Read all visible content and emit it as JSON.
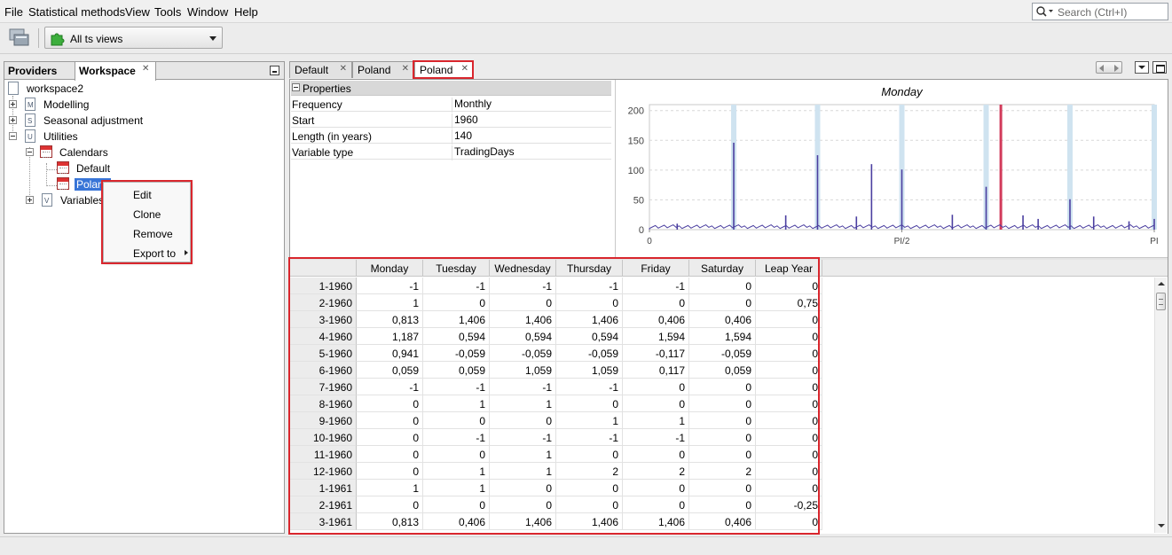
{
  "menubar": {
    "items": [
      "File",
      "Statistical methods",
      "View",
      "Tools",
      "Window",
      "Help"
    ],
    "search_placeholder": "Search (Ctrl+I)"
  },
  "toolbar": {
    "views_combo": "All ts views"
  },
  "left_panel": {
    "tabs": [
      "Providers",
      "Workspace"
    ],
    "tree": {
      "root": "workspace2",
      "modelling": "Modelling",
      "seasonal": "Seasonal adjustment",
      "utilities": "Utilities",
      "calendars": "Calendars",
      "cal_default": "Default",
      "cal_poland": "Poland",
      "variables": "Variables"
    },
    "icons": {
      "modelling": "M",
      "seasonal": "S",
      "utilities": "U",
      "variables": "V"
    }
  },
  "context_menu": {
    "items": [
      "Edit",
      "Clone",
      "Remove",
      "Export to"
    ]
  },
  "editor_tabs": [
    "Default",
    "Poland",
    "Poland"
  ],
  "properties": {
    "header": "Properties",
    "rows": [
      {
        "key": "Frequency",
        "value": "Monthly"
      },
      {
        "key": "Start",
        "value": "1960"
      },
      {
        "key": "Length (in years)",
        "value": "140"
      },
      {
        "key": "Variable type",
        "value": "TradingDays"
      }
    ]
  },
  "chart_data": {
    "type": "bar",
    "title": "Monday",
    "xlabel": "",
    "ylabel": "",
    "x_ticks": [
      "0",
      "PI/2",
      "PI"
    ],
    "y_ticks": [
      0,
      50,
      100,
      150,
      200
    ],
    "ylim": [
      0,
      210
    ],
    "xlim": [
      0,
      1
    ],
    "series_color": "#4b3fa0",
    "highlight_color": "#d23a5a",
    "band_color": "#cfe3f0",
    "peaks": [
      {
        "x": 0.167,
        "value": 146
      },
      {
        "x": 0.333,
        "value": 125
      },
      {
        "x": 0.5,
        "value": 101
      },
      {
        "x": 0.667,
        "value": 72
      },
      {
        "x": 0.833,
        "value": 51
      },
      {
        "x": 1.0,
        "value": 18
      },
      {
        "x": 0.44,
        "value": 110
      },
      {
        "x": 0.055,
        "value": 10
      },
      {
        "x": 0.27,
        "value": 24
      },
      {
        "x": 0.41,
        "value": 22
      },
      {
        "x": 0.6,
        "value": 25
      },
      {
        "x": 0.74,
        "value": 24
      },
      {
        "x": 0.77,
        "value": 18
      },
      {
        "x": 0.88,
        "value": 22
      },
      {
        "x": 0.95,
        "value": 14
      }
    ],
    "bands_x": [
      0.167,
      0.333,
      0.5,
      0.667,
      0.833,
      1.0
    ],
    "highlight_x": 0.697
  },
  "table": {
    "columns": [
      "Monday",
      "Tuesday",
      "Wednesday",
      "Thursday",
      "Friday",
      "Saturday",
      "Leap Year"
    ],
    "rows": [
      {
        "label": "1-1960",
        "values": [
          "-1",
          "-1",
          "-1",
          "-1",
          "-1",
          "0",
          "0"
        ]
      },
      {
        "label": "2-1960",
        "values": [
          "1",
          "0",
          "0",
          "0",
          "0",
          "0",
          "0,75"
        ]
      },
      {
        "label": "3-1960",
        "values": [
          "0,813",
          "1,406",
          "1,406",
          "1,406",
          "0,406",
          "0,406",
          "0"
        ]
      },
      {
        "label": "4-1960",
        "values": [
          "1,187",
          "0,594",
          "0,594",
          "0,594",
          "1,594",
          "1,594",
          "0"
        ]
      },
      {
        "label": "5-1960",
        "values": [
          "0,941",
          "-0,059",
          "-0,059",
          "-0,059",
          "-0,117",
          "-0,059",
          "0"
        ]
      },
      {
        "label": "6-1960",
        "values": [
          "0,059",
          "0,059",
          "1,059",
          "1,059",
          "0,117",
          "0,059",
          "0"
        ]
      },
      {
        "label": "7-1960",
        "values": [
          "-1",
          "-1",
          "-1",
          "-1",
          "0",
          "0",
          "0"
        ]
      },
      {
        "label": "8-1960",
        "values": [
          "0",
          "1",
          "1",
          "0",
          "0",
          "0",
          "0"
        ]
      },
      {
        "label": "9-1960",
        "values": [
          "0",
          "0",
          "0",
          "1",
          "1",
          "0",
          "0"
        ]
      },
      {
        "label": "10-1960",
        "values": [
          "0",
          "-1",
          "-1",
          "-1",
          "-1",
          "0",
          "0"
        ]
      },
      {
        "label": "11-1960",
        "values": [
          "0",
          "0",
          "1",
          "0",
          "0",
          "0",
          "0"
        ]
      },
      {
        "label": "12-1960",
        "values": [
          "0",
          "1",
          "1",
          "2",
          "2",
          "2",
          "0"
        ]
      },
      {
        "label": "1-1961",
        "values": [
          "1",
          "1",
          "0",
          "0",
          "0",
          "0",
          "0"
        ]
      },
      {
        "label": "2-1961",
        "values": [
          "0",
          "0",
          "0",
          "0",
          "0",
          "0",
          "-0,25"
        ]
      },
      {
        "label": "3-1961",
        "values": [
          "0,813",
          "0,406",
          "1,406",
          "1,406",
          "1,406",
          "0,406",
          "0"
        ]
      }
    ]
  },
  "accent": {
    "selection": "#3875d7",
    "annotation_red": "#d9262d"
  }
}
